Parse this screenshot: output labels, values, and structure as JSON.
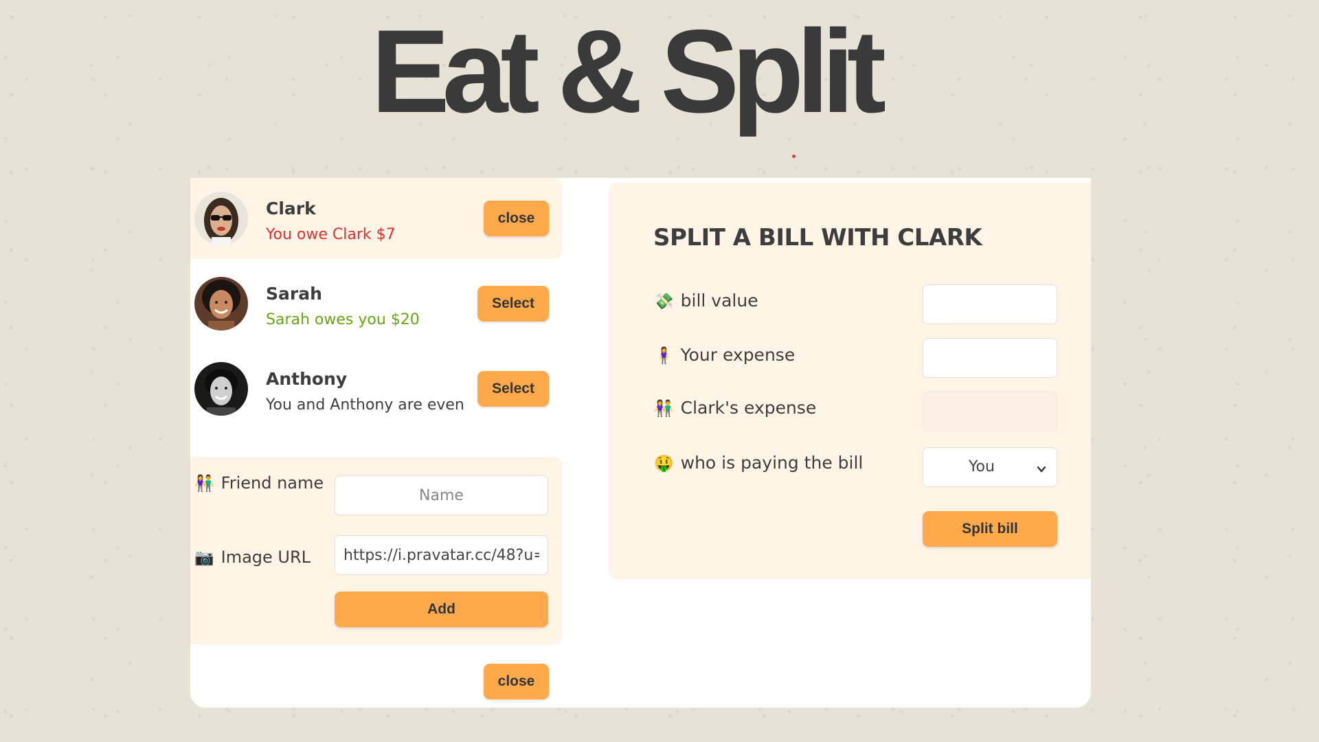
{
  "app": {
    "title": "Eat & Split"
  },
  "friends": [
    {
      "name": "Clark",
      "status": "You owe Clark $7",
      "status_color": "#e03131",
      "button_label": "close",
      "selected": true,
      "avatar_icon": "clark-avatar"
    },
    {
      "name": "Sarah",
      "status": "Sarah owes you $20",
      "status_color": "#66a80f",
      "button_label": "Select",
      "selected": false,
      "avatar_icon": "sarah-avatar"
    },
    {
      "name": "Anthony",
      "status": "You and Anthony are even",
      "status_color": "#3d3d3d",
      "button_label": "Select",
      "selected": false,
      "avatar_icon": "anthony-avatar"
    }
  ],
  "add_friend_form": {
    "name_label": "Friend name",
    "name_icon": "👫",
    "name_placeholder": "Name",
    "name_value": "",
    "image_label": "Image URL",
    "image_icon": "📷",
    "image_value": "https://i.pravatar.cc/48?u=",
    "submit_label": "Add"
  },
  "close_form_button": "close",
  "split_form": {
    "title": "SPLIT A BILL WITH CLARK",
    "bill_label": "bill value",
    "bill_icon": "💸",
    "bill_value": "",
    "expense_label": "Your expense",
    "expense_icon": "🧍‍♀️",
    "expense_value": "",
    "friend_expense_label": "Clark's expense",
    "friend_expense_icon": "👫",
    "friend_expense_value": "",
    "payer_label": "who is paying the bill",
    "payer_icon": "🤑",
    "payer_value": "You",
    "submit_label": "Split bill"
  },
  "colors": {
    "accent": "#ffa94d",
    "panel": "#fff4e6",
    "owe": "#e03131",
    "owed": "#66a80f",
    "text": "#3d3d3d"
  }
}
